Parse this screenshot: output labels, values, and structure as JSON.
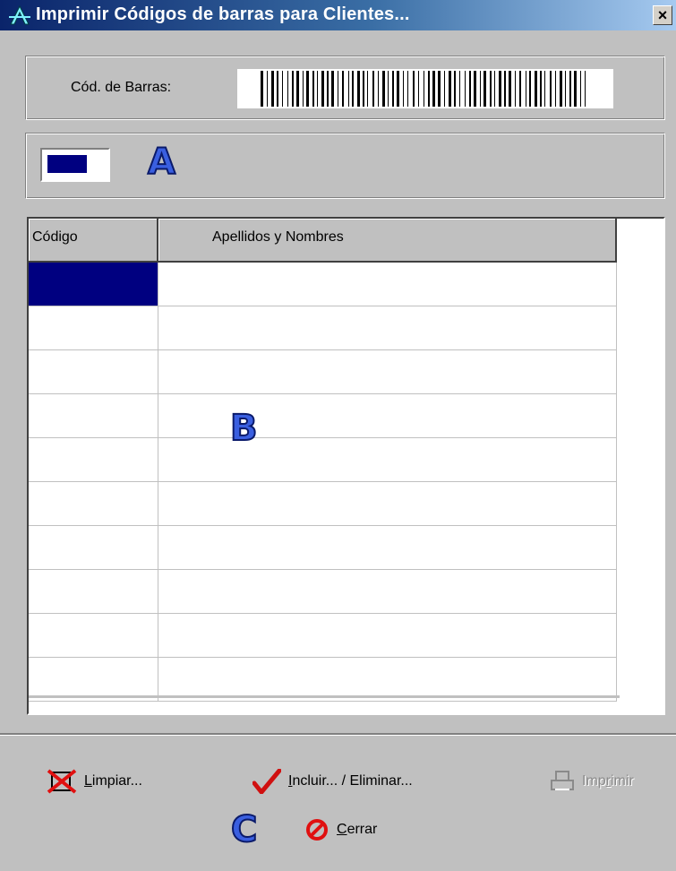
{
  "window": {
    "title": "Imprimir Códigos de barras para Clientes...",
    "close_label": "×"
  },
  "barcode": {
    "label": "Cód. de Barras:"
  },
  "annotations": {
    "a": "A",
    "b": "B",
    "c": "C"
  },
  "grid": {
    "columns": [
      "Código",
      "Apellidos y Nombres"
    ],
    "row_count": 10
  },
  "buttons": {
    "limpiar": {
      "first": "L",
      "rest": "impiar..."
    },
    "incluir": {
      "first": "I",
      "rest": "ncluir... / Eliminar..."
    },
    "imprimir": {
      "first": "Imp",
      "mid": "r",
      "rest": "imir"
    },
    "cerrar": {
      "first": "C",
      "rest": "errar"
    }
  },
  "colors": {
    "selection": "#000080",
    "annotation": "#3a5fe0",
    "titlebar_start": "#0a246a"
  },
  "icons": [
    "app-icon",
    "close-icon",
    "barcode-image",
    "clear-icon",
    "checkmark-icon",
    "printer-icon",
    "no-entry-icon"
  ]
}
